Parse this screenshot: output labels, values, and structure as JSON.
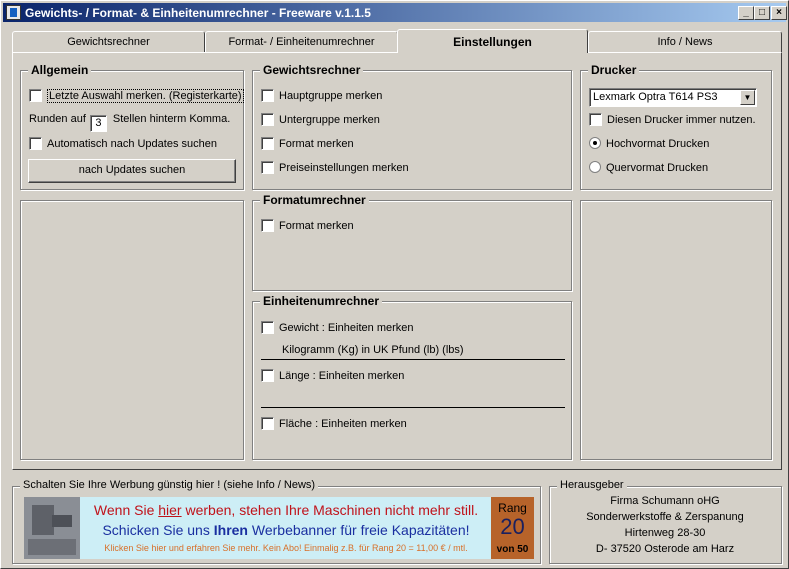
{
  "window": {
    "title": "Gewichts- / Format- & Einheitenumrechner - Freeware v.1.1.5",
    "controls": [
      "_",
      "□",
      "×"
    ]
  },
  "tabs": [
    {
      "label": "Gewichtsrechner",
      "active": false
    },
    {
      "label": "Format- / Einheitenumrechner",
      "active": false
    },
    {
      "label": "Einstellungen",
      "active": true
    },
    {
      "label": "Info / News",
      "active": false
    }
  ],
  "allgemein": {
    "title": "Allgemein",
    "remember_tab": "Letzte Auswahl merken. (Registerkarte)",
    "round_prefix": "Runden auf",
    "round_value": "3",
    "round_suffix": "Stellen hinterm Komma.",
    "auto_update": "Automatisch nach Updates suchen",
    "update_button": "nach Updates suchen"
  },
  "gewichtsrechner": {
    "title": "Gewichtsrechner",
    "items": [
      "Hauptgruppe merken",
      "Untergruppe merken",
      "Format merken",
      "Preiseinstellungen merken"
    ]
  },
  "drucker": {
    "title": "Drucker",
    "selected": "Lexmark Optra T614 PS3",
    "always_use": "Diesen Drucker immer nutzen.",
    "portrait": "Hochvormat Drucken",
    "landscape": "Quervormat Drucken",
    "orientation": "portrait"
  },
  "formatumrechner": {
    "title": "Formatumrechner",
    "item": "Format merken"
  },
  "einheitenumrechner": {
    "title": "Einheitenumrechner",
    "weight": "Gewicht : Einheiten merken",
    "weight_units": "Kilogramm (Kg)  in  UK Pfund (lb) (lbs)",
    "length": "Länge : Einheiten merken",
    "area": "Fläche : Einheiten merken"
  },
  "werbung": {
    "title": "Schalten Sie Ihre Werbung günstig hier ! (siehe Info / News)",
    "line1_a": "Wenn Sie ",
    "line1_link": "hier",
    "line1_b": " werben, stehen Ihre Maschinen nicht mehr still.",
    "line2_a": "Schicken Sie uns ",
    "line2_bold": "Ihren",
    "line2_b": " Werbebanner für freie Kapazitäten!",
    "line3": "Klicken Sie hier und erfahren Sie mehr. Kein Abo! Einmalig z.B. für Rang 20 = 11,00 € / mtl.",
    "rank_label": "Rang",
    "rank_value": "20",
    "rank_of": "von 50"
  },
  "herausgeber": {
    "title": "Herausgeber",
    "lines": [
      "Firma Schumann oHG",
      "Sonderwerkstoffe & Zerspanung",
      "Hirtenweg 28-30",
      "D- 37520 Osterode am Harz"
    ]
  },
  "colors": {
    "titlebar_start": "#0a246a",
    "titlebar_end": "#a6caf0",
    "banner_red": "#c0121a",
    "banner_blue": "#1a2fa0",
    "banner_orange": "#d8702a"
  }
}
